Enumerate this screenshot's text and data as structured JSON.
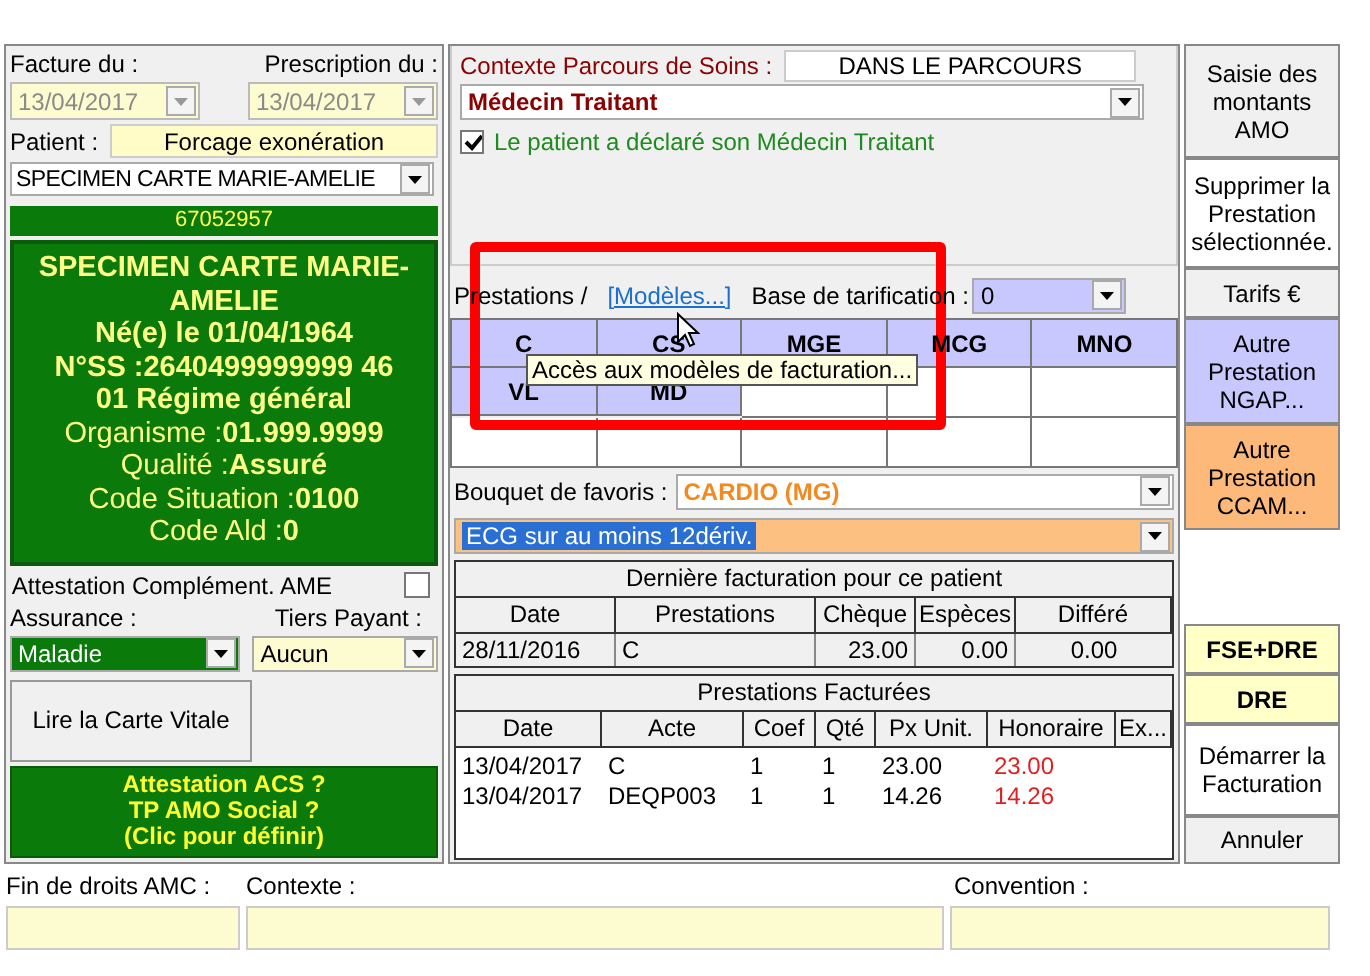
{
  "invoice": {
    "facture_label": "Facture du :",
    "prescription_label": "Prescription du :",
    "facture_date": {
      "value": "13/04/2017",
      "disabled": true
    },
    "prescription_date": {
      "value": "13/04/2017",
      "disabled": true
    }
  },
  "patient": {
    "label": "Patient :",
    "exoneration_button": "Forcage exonération",
    "select": "SPECIMEN CARTE MARIE-AMELIE",
    "number": "67052957",
    "card_lines": [
      "SPECIMEN CARTE MARIE-AMELIE",
      "Né(e) le 01/04/1964",
      "N°SS :2640499999999 46",
      "01 Régime général",
      "Organisme :**01.999.9999**",
      "Qualité :**Assuré**",
      "Code Situation :**0100**",
      "Code Ald :**0**"
    ]
  },
  "ame": {
    "label": "Attestation Complément. AME",
    "checked": false
  },
  "assurance": {
    "label": "Assurance :",
    "value": "Maladie"
  },
  "tiers_payant": {
    "label": "Tiers Payant :",
    "value": "Aucun"
  },
  "read_card_button": "Lire la Carte Vitale",
  "acs_button": [
    "Attestation ACS ?",
    "TP AMO Social ?",
    "(Clic pour définir)"
  ],
  "parcours": {
    "legend": "Contexte Parcours de Soins  :",
    "status": "DANS LE PARCOURS",
    "select": "Médecin Traitant",
    "declared": {
      "label": "Le patient a déclaré son Médecin Traitant",
      "checked": true
    }
  },
  "prestations": {
    "label": "Prestations /",
    "models_link": "[Modèles...]",
    "base_label": "Base de tarification :",
    "base_value": "0",
    "codes": [
      "C",
      "CS",
      "MGE",
      "MCG",
      "MNO",
      "VL",
      "MD"
    ],
    "tooltip": "Accès aux modèles de facturation..."
  },
  "favoris": {
    "label": "Bouquet de favoris :",
    "value": "CARDIO (MG)",
    "act": "ECG sur au moins 12dériv."
  },
  "last_billing": {
    "title": "Dernière facturation pour ce patient",
    "columns": [
      "Date",
      "Prestations",
      "Chèque",
      "Espèces",
      "Différé"
    ],
    "rows": [
      [
        "28/11/2016",
        "C",
        "23.00",
        "0.00",
        "0.00"
      ]
    ]
  },
  "billed": {
    "title": "Prestations Facturées",
    "columns": [
      "Date",
      "Acte",
      "Coef",
      "Qté",
      "Px Unit.",
      "Honoraire",
      "Ex..."
    ],
    "rows": [
      [
        "13/04/2017",
        "C",
        "1",
        "1",
        "23.00",
        "23.00"
      ],
      [
        "13/04/2017",
        "DEQP003",
        "1",
        "1",
        "14.26",
        "14.26"
      ]
    ]
  },
  "actions": [
    {
      "label": "Saisie des montants AMO",
      "kind": "plain"
    },
    {
      "label": "Supprimer la Prestation sélectionnée.",
      "kind": "white"
    },
    {
      "label": "Tarifs €",
      "kind": "plain"
    },
    {
      "label": "Autre Prestation NGAP...",
      "kind": "ngap"
    },
    {
      "label": "Autre Prestation CCAM...",
      "kind": "ccam"
    },
    {
      "label": "FSE+DRE",
      "kind": "yellow"
    },
    {
      "label": "DRE",
      "kind": "yellow"
    },
    {
      "label": "Démarrer la Facturation",
      "kind": "white"
    },
    {
      "label": "Annuler",
      "kind": "plain"
    }
  ],
  "footer": [
    {
      "label": "Fin de droits AMC :"
    },
    {
      "label": "Contexte :"
    },
    {
      "label": "Convention :"
    }
  ]
}
